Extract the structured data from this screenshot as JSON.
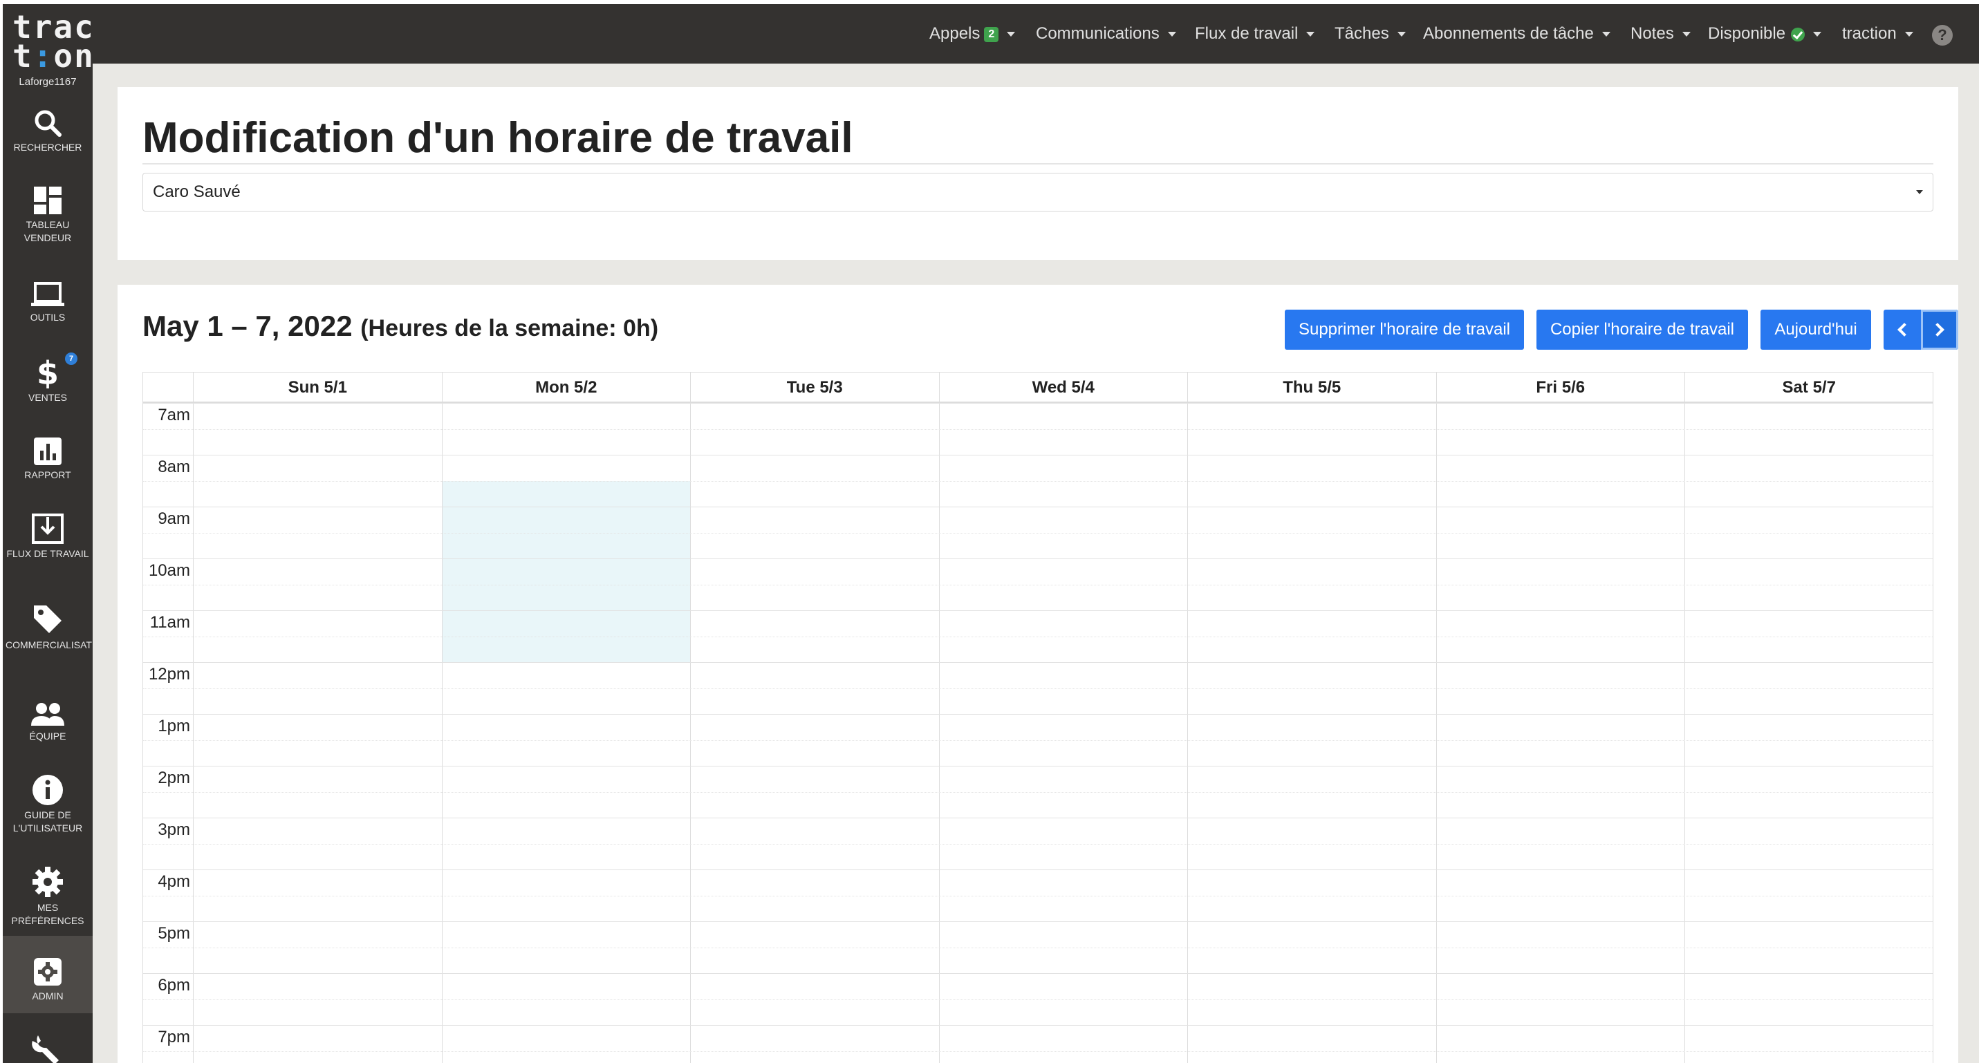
{
  "sidebar": {
    "logo_line1": "trac",
    "logo_line2_a": "t",
    "logo_line2_colon": ":",
    "logo_line2_b": "on",
    "username": "Laforge1167",
    "items": [
      {
        "label": "Rechercher",
        "icon": "search-icon"
      },
      {
        "label": "Tableau vendeur",
        "icon": "dashboard-icon"
      },
      {
        "label": "Outils",
        "icon": "laptop-icon"
      },
      {
        "label": "Ventes",
        "icon": "dollar-icon",
        "badge": "7"
      },
      {
        "label": "Rapport",
        "icon": "bar-chart-icon"
      },
      {
        "label": "Flux de travail",
        "icon": "download-tray-icon"
      },
      {
        "label": "Commercialisation",
        "icon": "tag-icon"
      },
      {
        "label": "Équipe",
        "icon": "people-icon"
      },
      {
        "label": "Guide de l'utilisateur",
        "icon": "info-icon"
      },
      {
        "label": "Mes préférences",
        "icon": "gear-icon"
      },
      {
        "label": "Admin",
        "icon": "admin-gear-icon"
      },
      {
        "label": "",
        "icon": "wrench-icon"
      }
    ]
  },
  "topbar": {
    "appels": "Appels",
    "appels_badge": "2",
    "communications": "Communications",
    "flux": "Flux de travail",
    "taches": "Tâches",
    "abonnements": "Abonnements de tâche",
    "notes": "Notes",
    "disponible": "Disponible",
    "user_menu": "traction",
    "help": "?"
  },
  "page": {
    "title": "Modification d'un horaire de travail",
    "employee": "Caro Sauvé"
  },
  "calendar": {
    "range": "May 1 – 7, 2022",
    "hours_summary": "(Heures de la semaine: 0h)",
    "btn_delete": "Supprimer l'horaire de travail",
    "btn_copy": "Copier l'horaire de travail",
    "btn_today": "Aujourd'hui",
    "days": [
      "Sun 5/1",
      "Mon 5/2",
      "Tue 5/3",
      "Wed 5/4",
      "Thu 5/5",
      "Fri 5/6",
      "Sat 5/7"
    ],
    "times": [
      "7am",
      "8am",
      "9am",
      "10am",
      "11am",
      "12pm",
      "1pm",
      "2pm",
      "3pm",
      "4pm",
      "5pm",
      "6pm",
      "7pm"
    ],
    "highlight": {
      "day": "Mon 5/2",
      "start": "8:30am",
      "end": "12pm"
    }
  }
}
